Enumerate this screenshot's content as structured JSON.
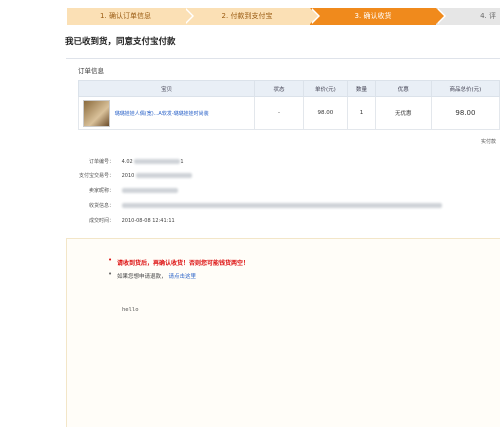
{
  "steps": [
    {
      "label": "1. 确认订单信息"
    },
    {
      "label": "2. 付款到支付宝"
    },
    {
      "label": "3. 确认收货"
    },
    {
      "label": "4. 评"
    }
  ],
  "heading": "我已收到货，同意支付宝付款",
  "order_panel": {
    "title": "订单信息",
    "columns": [
      "宝贝",
      "状态",
      "单价(元)",
      "数量",
      "优惠",
      "商品总价(元)"
    ],
    "rows": [
      {
        "product": "璐璐娃娃人偶(宽)...A软发-璐璐娃娃时尚装",
        "status": "-",
        "price": "98.00",
        "qty": "1",
        "discount": "无优惠",
        "total": "98.00"
      }
    ],
    "actual_pay_label": "实付款"
  },
  "info": [
    {
      "label": "订单编号：",
      "value": "4.02"
    },
    {
      "label": "支付宝交易号：",
      "value": "2010"
    },
    {
      "label": "卖家昵称：",
      "value": ""
    },
    {
      "label": "收货信息：",
      "value": ""
    },
    {
      "label": "成交时间：",
      "value": "2010-08-08 12:41:11"
    }
  ],
  "notice": {
    "warning": "请收到货后，再确认收货！否则您可能钱货两空！",
    "dispute_text": "如果您想申请退款，",
    "dispute_link": "请点击这里"
  },
  "hello_text": "hello",
  "colors": {
    "active_step": "#f08a1c",
    "done_step": "#fbe0b5",
    "warning": "#dd1111",
    "link": "#2a62c8"
  }
}
